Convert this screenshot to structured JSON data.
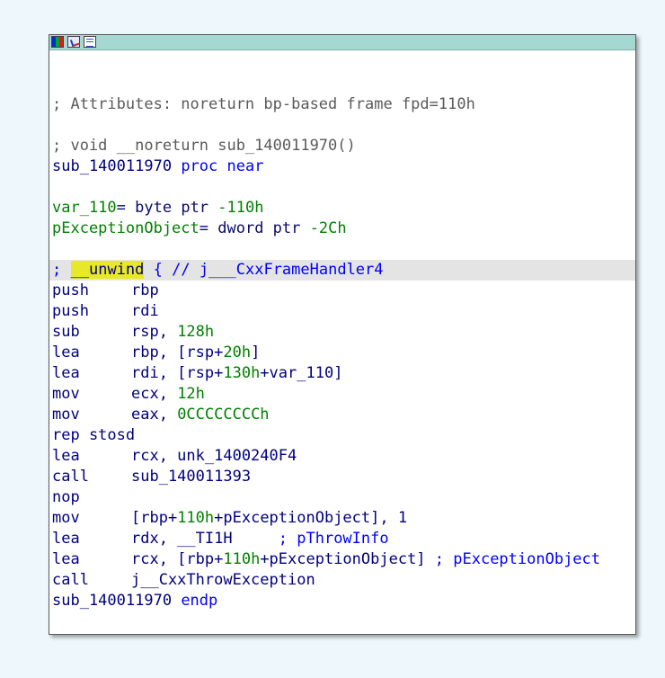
{
  "window": {
    "toolbar_icons": [
      "graph-view-icon",
      "edit-icon",
      "listing-icon"
    ]
  },
  "colors": {
    "background": "#eef8fc",
    "titlebar": "#a6d8d2",
    "comment": "#5a5a5a",
    "keyword_blue": "#0000ff",
    "number_green": "#008000",
    "highlight": "#e8e82a"
  },
  "code": {
    "attributes_comment": "; Attributes: noreturn bp-based frame fpd=110h",
    "prototype_comment": "; void __noreturn sub_140011970()",
    "proc_name": "sub_140011970",
    "proc_kw": "proc near",
    "var1_name": "var_110",
    "var1_eq": "=",
    "var1_type": "byte ptr",
    "var1_val": "-110h",
    "var2_name": "pExceptionObject",
    "var2_eq": "=",
    "var2_type": "dword ptr",
    "var2_val": "-2Ch",
    "unwind_semicolon": ";",
    "unwind_word": "__unwind",
    "unwind_rest": "{ // j___CxxFrameHandler4",
    "instructions": [
      {
        "mnem": "push",
        "pre": "rbp",
        "num": "",
        "post": ""
      },
      {
        "mnem": "push",
        "pre": "rdi",
        "num": "",
        "post": ""
      },
      {
        "mnem": "sub",
        "pre": "rsp, ",
        "num": "128h",
        "post": ""
      },
      {
        "mnem": "lea",
        "pre": "rbp, [rsp+",
        "num": "20h",
        "post": "]"
      },
      {
        "mnem": "lea",
        "pre": "rdi, [rsp+",
        "num": "130h",
        "post": "+var_110]"
      },
      {
        "mnem": "mov",
        "pre": "ecx, ",
        "num": "12h",
        "post": ""
      },
      {
        "mnem": "mov",
        "pre": "eax, ",
        "num": "0CCCCCCCCh",
        "post": ""
      },
      {
        "mnem": "rep stosd",
        "pre": "",
        "num": "",
        "post": ""
      },
      {
        "mnem": "lea",
        "pre": "rcx, unk_1400240F4",
        "num": "",
        "post": ""
      },
      {
        "mnem": "call",
        "pre": "sub_140011393",
        "num": "",
        "post": ""
      },
      {
        "mnem": "nop",
        "pre": "",
        "num": "",
        "post": ""
      },
      {
        "mnem": "mov",
        "pre": "[rbp+",
        "num": "110h",
        "post": "+pExceptionObject], 1"
      },
      {
        "mnem": "lea",
        "pre": "rdx, __TI1H",
        "num": "",
        "post": "     ; pThrowInfo"
      },
      {
        "mnem": "lea",
        "pre": "rcx, [rbp+",
        "num": "110h",
        "post": "+pExceptionObject] ; pExceptionObject"
      },
      {
        "mnem": "call",
        "pre": "j__CxxThrowException",
        "num": "",
        "post": ""
      }
    ],
    "endp_name": "sub_140011970",
    "endp_kw": "endp"
  }
}
